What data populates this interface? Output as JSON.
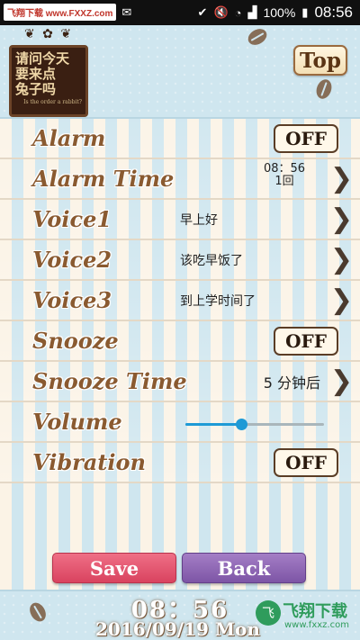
{
  "status_bar": {
    "watermark": "飞翔下载 www.FXXZ.com",
    "battery": "100%",
    "time": "08:56",
    "icons": [
      "email-icon",
      "check-icon",
      "no-sound-icon",
      "wifi-icon",
      "signal-icon",
      "battery-icon"
    ]
  },
  "header": {
    "sign_text_lines": [
      "请问今天",
      "要来点",
      "兔子吗"
    ],
    "sign_subtext": "Is the order a rabbit?",
    "top_button": "Top"
  },
  "settings": {
    "alarm": {
      "label": "Alarm",
      "toggle": "OFF"
    },
    "alarm_time": {
      "label": "Alarm Time",
      "time": "08：56",
      "repeat": "1回"
    },
    "voice1": {
      "label": "Voice1",
      "value": "早上好"
    },
    "voice2": {
      "label": "Voice2",
      "value": "该吃早饭了"
    },
    "voice3": {
      "label": "Voice3",
      "value": "到上学时间了"
    },
    "snooze": {
      "label": "Snooze",
      "toggle": "OFF"
    },
    "snooze_time": {
      "label": "Snooze Time",
      "value": "5 分钟后"
    },
    "volume": {
      "label": "Volume",
      "level": 0.4
    },
    "vibration": {
      "label": "Vibration",
      "toggle": "OFF"
    }
  },
  "buttons": {
    "save": "Save",
    "back": "Back"
  },
  "footer": {
    "clock": "08：56",
    "date": "2016/09/19  Mon",
    "watermark_cn": "飞翔下载",
    "watermark_url": "www.fxxz.com"
  },
  "colors": {
    "label": "#8a5a30",
    "save_button": "#d9435f",
    "back_button": "#7d55a6",
    "slider": "#1e9ad6"
  }
}
